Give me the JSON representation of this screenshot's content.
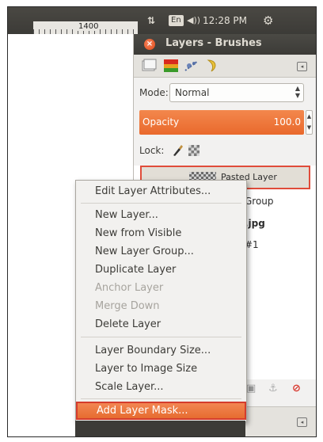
{
  "panel": {
    "ruler_label": "1400",
    "keyboard_layout": "En",
    "time": "12:28 PM",
    "icons": [
      "network-icon",
      "volume-icon",
      "gear-icon"
    ]
  },
  "dock": {
    "title": "Layers - Brushes",
    "tabs": [
      "paths-tab",
      "layers-tab",
      "brushes-tab",
      "patterns-tab"
    ],
    "mode_label": "Mode:",
    "mode_value": "Normal",
    "opacity_label": "Opacity",
    "opacity_value": "100.0",
    "lock_label": "Lock:",
    "layers": [
      {
        "name": "Pasted Layer",
        "selected": true
      },
      {
        "name": "Group"
      },
      {
        "name": ".jpg"
      },
      {
        "name": "#1"
      }
    ],
    "accent_color": "#e9692c",
    "highlight_color": "#e04c3a"
  },
  "context_menu": {
    "items": [
      {
        "label": "Edit Layer Attributes...",
        "enabled": true
      },
      {
        "label": "New Layer...",
        "enabled": true
      },
      {
        "label": "New from Visible",
        "enabled": true
      },
      {
        "label": "New Layer Group...",
        "enabled": true
      },
      {
        "label": "Duplicate Layer",
        "enabled": true
      },
      {
        "label": "Anchor Layer",
        "enabled": false
      },
      {
        "label": "Merge Down",
        "enabled": false
      },
      {
        "label": "Delete Layer",
        "enabled": true
      },
      {
        "label": "Layer Boundary Size...",
        "enabled": true
      },
      {
        "label": "Layer to Image Size",
        "enabled": true
      },
      {
        "label": "Scale Layer...",
        "enabled": true
      },
      {
        "label": "Add Layer Mask...",
        "enabled": true,
        "highlighted": true
      }
    ]
  }
}
